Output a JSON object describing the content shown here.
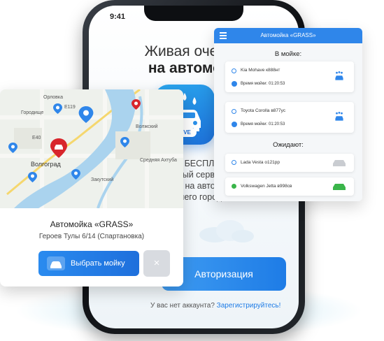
{
  "phone": {
    "status_time": "9:41",
    "hero_line1": "Живая очередь",
    "hero_line2": "на автомойку",
    "app_icon_badge": "LIVE",
    "description": "Бесплатно БЕСПЛАТНЫЙ мобильный сервис для записи на автомойки вашего города",
    "description_lines": [
      "сплатно БЕСПЛАТНЫЙ",
      "обильный сервис для",
      "записи на автомойки",
      "вашего города"
    ],
    "auth_button": "Авторизация",
    "signup_prompt": "У вас нет аккаунта?",
    "signup_link": "Зарегистрируйтесь!"
  },
  "map_card": {
    "map_labels": [
      "Орловка",
      "Городище",
      "Е40",
      "Е119",
      "Волжский",
      "Волгоград",
      "Средняя Ахтуба",
      "Закутский"
    ],
    "title": "Автомойка «GRASS»",
    "address": "Героев Тулы 6/14 (Спартановка)",
    "choose_button": "Выбрать мойку",
    "close_label": "×"
  },
  "queue_panel": {
    "header_title": "Автомойка «GRASS»",
    "in_wash_title": "В мойке:",
    "waiting_title": "Ожидают:",
    "time_label": "Время мойки:",
    "in_wash": [
      {
        "car": "Kia Mohave к888нт",
        "time": "01:20:53"
      },
      {
        "car": "Toyota Corolla в877ус",
        "time": "01:20:53"
      }
    ],
    "waiting": [
      {
        "car": "Lada Vesta о121рр",
        "status": "waiting"
      },
      {
        "car": "Volkswagen Jetta в998св",
        "status": "next"
      }
    ]
  },
  "colors": {
    "accent": "#2f86ea",
    "button": "#1e7ce6",
    "green": "#3ab54a",
    "pin_red": "#d8262c"
  }
}
